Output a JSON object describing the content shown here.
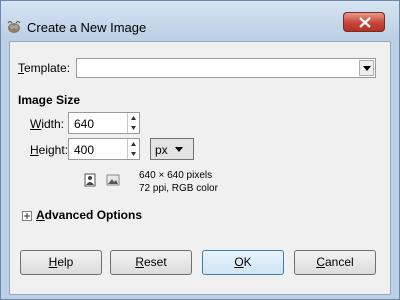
{
  "window": {
    "title": "Create a New Image"
  },
  "template": {
    "label": "Template:",
    "value": ""
  },
  "image_size": {
    "heading": "Image Size",
    "width_label": "Width:",
    "width_value": "640",
    "height_label": "Height:",
    "height_value": "400",
    "unit": "px",
    "info_line1": "640 × 640 pixels",
    "info_line2": "72 ppi, RGB color"
  },
  "advanced": {
    "label": "Advanced Options"
  },
  "buttons": {
    "help": "Help",
    "reset": "Reset",
    "ok": "OK",
    "cancel": "Cancel"
  },
  "icons": {
    "app": "gimp-app-icon",
    "close": "close-icon",
    "template_dropdown": "chevron-down-icon",
    "portrait": "portrait-orientation-icon",
    "landscape": "landscape-orientation-icon",
    "expander": "plus-expander-icon"
  }
}
